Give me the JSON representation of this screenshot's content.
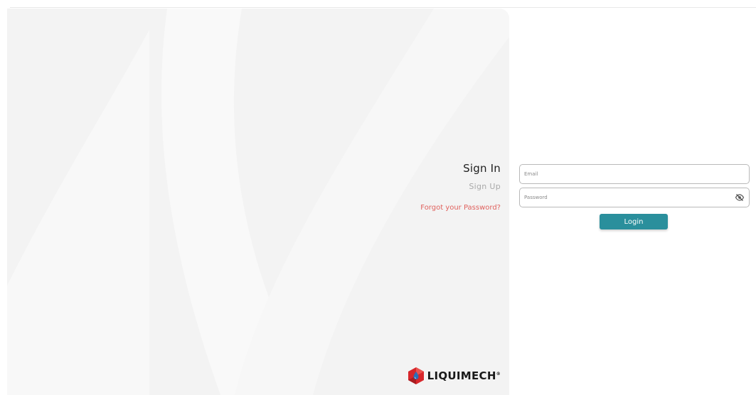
{
  "auth": {
    "sign_in_label": "Sign In",
    "sign_up_label": "Sign Up",
    "forgot_label": "Forgot your Password?"
  },
  "form": {
    "email_placeholder": "Email",
    "email_value": "",
    "password_placeholder": "Password",
    "password_value": "",
    "login_label": "Login"
  },
  "brand": {
    "name": "LIQUIMECH",
    "registered_mark": "®",
    "logo_icon": "liquimech-hexagon-icon"
  },
  "icons": {
    "password_toggle": "eye-slash-icon"
  },
  "colors": {
    "accent": "#2a8f9c",
    "link_warning": "#e0625e",
    "panel_bg": "#f3f3f3",
    "logo_red": "#d7262b"
  }
}
